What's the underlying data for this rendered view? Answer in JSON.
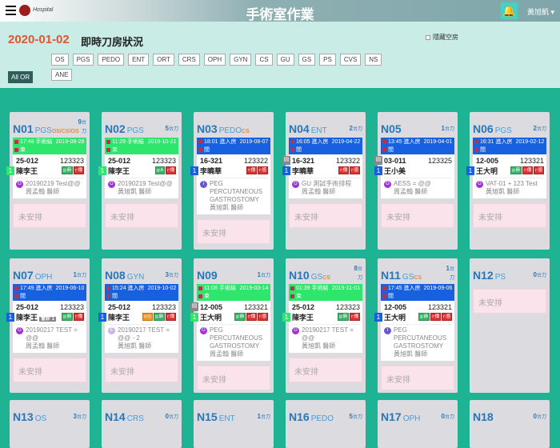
{
  "header": {
    "title": "手術室作業",
    "user": "黃旭凱 ▾",
    "logo_text": "Hospital"
  },
  "toolbar": {
    "date": "2020-01-02",
    "subtitle": "即時刀房狀況",
    "hide_empty": "隱藏空房",
    "all_or": "All OR",
    "filters": [
      "OS",
      "PGS",
      "PEDO",
      "ENT",
      "ORT",
      "CRS",
      "OPH",
      "GYN",
      "CS",
      "GU",
      "GS",
      "PS",
      "CVS",
      "NS",
      "ANE"
    ]
  },
  "count_unit": "台刀",
  "pending_label": "未安排",
  "colors": {
    "accent": "#1db393",
    "green_status": "#2ee66b",
    "blue_status": "#1760e0",
    "date": "#e0562f"
  },
  "rooms": [
    {
      "room": "N01",
      "spec": "PGS",
      "extra": "OS/CS/OS",
      "count": "9",
      "status": "green",
      "time": "17:48 手術結束",
      "date": "2019-08-28",
      "bed": "25-012",
      "chart": "123323",
      "name": "陳李王",
      "seq": "1",
      "badges": [
        "g:麻",
        "r:傳"
      ],
      "letter": "G",
      "proc": "20190219 Test@@",
      "doctor": "周孟翰 醫師"
    },
    {
      "room": "N02",
      "spec": "PGS",
      "count": "5",
      "status": "green",
      "time": "11:29 手術結束",
      "date": "2019-10-21",
      "bed": "25-012",
      "chart": "123323",
      "name": "陳李王",
      "seq": "1",
      "badges": [
        "g:A",
        "r:傳"
      ],
      "letter": "G",
      "proc": "20190219 Test@@",
      "doctor": "黃旭凱 醫師"
    },
    {
      "room": "N03",
      "spec": "PEDO",
      "extra": "CS",
      "status": "blue",
      "time": "18:01 進入房間",
      "date": "2019-08-07",
      "bed": "16-321",
      "chart": "123322",
      "name": "李曉華",
      "seq": "1",
      "badges": [
        "r:傳",
        "r:感"
      ],
      "letter": "I",
      "proc": "PEG PERCUTANEOUS GASTROSTOMY",
      "doctor": "黃旭凱 醫師"
    },
    {
      "room": "N04",
      "spec": "ENT",
      "count": "2",
      "status": "blue",
      "time": "16:05 進入房間",
      "date": "2019-04-22",
      "bed": "16-321",
      "chart": "123322",
      "name": "李曉華",
      "seq": "1",
      "gi": true,
      "badges": [
        "r:傳",
        "r:感"
      ],
      "letter": "G",
      "proc": "GU 測試手術排程",
      "doctor": "周孟翰 醫師"
    },
    {
      "room": "N05",
      "spec": "",
      "count": "1",
      "status": "blue",
      "time": "13:45 進入房間",
      "date": "2019-04-01",
      "bed": "03-011",
      "chart": "123325",
      "name": "王小美",
      "seq": "1",
      "gi": true,
      "badges": [],
      "letter": "G",
      "proc": "AESS = @@",
      "doctor": "周孟翰 醫師"
    },
    {
      "room": "N06",
      "spec": "PGS",
      "count": "2",
      "status": "blue",
      "time": "16:31 進入房間",
      "date": "2019-02-12",
      "bed": "12-005",
      "chart": "123321",
      "name": "王大明",
      "seq": "1",
      "badges": [
        "g:麻",
        "r:傳",
        "r:感"
      ],
      "letter": "G",
      "proc": "VAT-01 + 123 Test",
      "doctor": "黃旭凱 醫師"
    },
    {
      "room": "N07",
      "spec": "OPH",
      "count": "1",
      "status": "blue",
      "time": "17:49 進入房間",
      "date": "2019-06-10",
      "bed": "25-012",
      "chart": "123323",
      "name": "陳李王",
      "tag": "會診 1",
      "seq": "1",
      "badges": [
        "g:麻",
        "r:傳"
      ],
      "letter": "G",
      "proc": "20190217 TEST = @@",
      "doctor": "周孟翰 醫師"
    },
    {
      "room": "N08",
      "spec": "GYN",
      "count": "3",
      "status": "blue",
      "time": "15:24 進入房間",
      "date": "2019-10-02",
      "bed": "25-012",
      "chart": "123323",
      "name": "陳李王",
      "seq": "1",
      "badges": [
        "o:◷",
        "g:麻",
        "r:傳"
      ],
      "letter": "E",
      "proc": "20190217 TEST = @@ - 2",
      "doctor": "黃旭凱 醫師"
    },
    {
      "room": "N09",
      "spec": "",
      "count": "1",
      "status": "green",
      "time": "11:06 手術結束",
      "date": "2019-03-14",
      "bed": "12-005",
      "chart": "123321",
      "name": "王大明",
      "seq": "1",
      "gi": true,
      "badges": [
        "g:麻",
        "r:傳",
        "r:感"
      ],
      "letter": "G",
      "proc": "PEG PERCUTANEOUS GASTROSTOMY",
      "doctor": "周孟翰 醫師"
    },
    {
      "room": "N10",
      "spec": "GS",
      "extra": "CS",
      "count": "8",
      "status": "green",
      "time": "01:39 手術結束",
      "date": "2019-11-01",
      "bed": "25-012",
      "chart": "123323",
      "name": "陳李王",
      "seq": "1",
      "badges": [
        "g:麻",
        "r:傳"
      ],
      "letter": "G",
      "proc": "20190217 TEST = @@",
      "doctor": "黃旭凱 醫師"
    },
    {
      "room": "N11",
      "spec": "GS",
      "extra": "CS",
      "count": "1",
      "status": "blue",
      "time": "17:45 進入房間",
      "date": "2019-09-06",
      "bed": "12-005",
      "chart": "123321",
      "name": "王大明",
      "seq": "1",
      "badges": [
        "g:麻",
        "r:傳",
        "r:感"
      ],
      "letter": "I",
      "proc": "PEG PERCUTANEOUS GASTROSTOMY",
      "doctor": "黃旭凱 醫師"
    },
    {
      "room": "N12",
      "spec": "PS",
      "count": "0"
    },
    {
      "room": "N13",
      "spec": "OS",
      "count": "3"
    },
    {
      "room": "N14",
      "spec": "CRS",
      "count": "0"
    },
    {
      "room": "N15",
      "spec": "ENT",
      "count": "1"
    },
    {
      "room": "N16",
      "spec": "PEDO",
      "count": "5"
    },
    {
      "room": "N17",
      "spec": "OPH",
      "count": "0"
    },
    {
      "room": "N18",
      "spec": "",
      "count": "0"
    }
  ]
}
